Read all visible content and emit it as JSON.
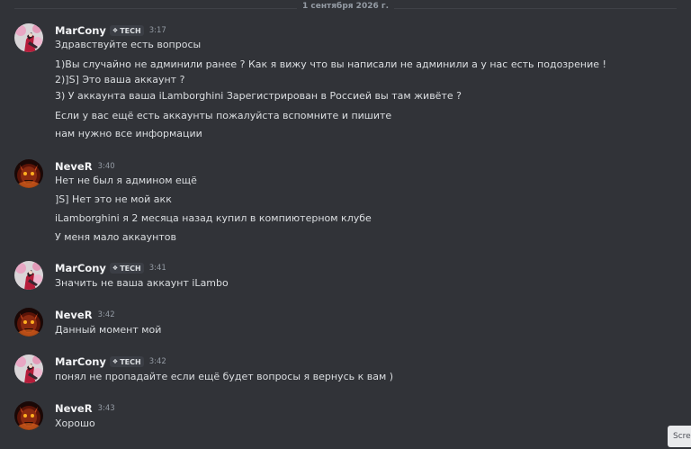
{
  "date_divider": "1 сентября 2026 г.",
  "users": {
    "marcony": {
      "name": "MarCony",
      "tag": "TECH",
      "tag_icon": "tech-badge-icon"
    },
    "never": {
      "name": "NeveR"
    }
  },
  "messages": [
    {
      "author": "MarCony",
      "tag": "TECH",
      "time": "3:17",
      "lines": [
        "Здравствуйте есть вопросы",
        "1)Вы случайно не админили ранее  ? Как я вижу что вы написали не админили а у нас есть подозрение !",
        "2)]S] Это ваша аккаунт ?",
        "3) У аккаунта ваша iLamborghini  Зарегистрирован в Россией  вы там живёте ?",
        "Если у вас ещё есть аккаунты пожалуйста  вспомните  и пишите",
        "нам нужно все информации"
      ]
    },
    {
      "author": "NeveR",
      "time": "3:40",
      "lines": [
        "Нет не был я админом ещё",
        "]S] Нет это не мой акк",
        "iLamborghini я 2 месяца назад купил в компиютерном клубе",
        "У меня мало аккаунтов"
      ]
    },
    {
      "author": "MarCony",
      "tag": "TECH",
      "time": "3:41",
      "lines": [
        "Значить не ваша аккаунт iLambo"
      ]
    },
    {
      "author": "NeveR",
      "time": "3:42",
      "lines": [
        "Данный момент мой"
      ]
    },
    {
      "author": "MarCony",
      "tag": "TECH",
      "time": "3:42",
      "lines": [
        "понял не пропадайте если ещё будет вопросы я вернусь к вам )"
      ]
    },
    {
      "author": "NeveR",
      "time": "3:43",
      "lines": [
        "Хорошо"
      ]
    }
  ],
  "screen_button": "Scre",
  "colors": {
    "background": "#313338",
    "text": "#dbdee1",
    "username": "#f2f3f5",
    "muted": "#949ba4"
  }
}
